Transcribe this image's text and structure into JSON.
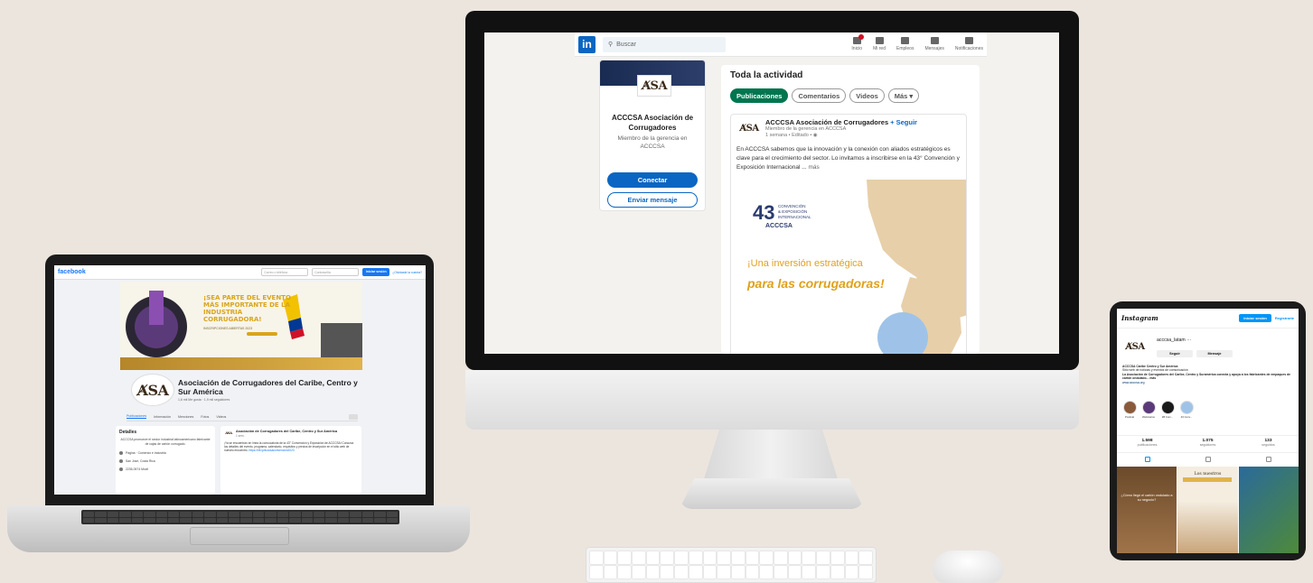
{
  "brand": {
    "logo_text": "A̸SA"
  },
  "linkedin": {
    "logo": "in",
    "search_placeholder": "Buscar",
    "nav": [
      {
        "label": "Inicio",
        "icon": "home-icon"
      },
      {
        "label": "Mi red",
        "icon": "network-icon"
      },
      {
        "label": "Empleos",
        "icon": "briefcase-icon"
      },
      {
        "label": "Mensajes",
        "icon": "message-icon"
      },
      {
        "label": "Notificaciones",
        "icon": "bell-icon"
      }
    ],
    "profile": {
      "logo": "A̸SA",
      "name": "ACCCSA Asociación de Corrugadores",
      "subtitle": "Miembro de la gerencia en ACCCSA",
      "connect_label": "Conectar",
      "message_label": "Enviar mensaje"
    },
    "feed": {
      "title": "Toda la actividad",
      "tabs": [
        "Publicaciones",
        "Comentarios",
        "Videos",
        "Más ▾"
      ],
      "post": {
        "author": "ACCCSA Asociación de Corrugadores",
        "follow_label": "+ Seguir",
        "meta_line1": "Miembro de la gerencia en ACCCSA",
        "meta_line2": "1 semana • Editado •",
        "text": "En ACCCSA sabemos que la innovación y la conexión con aliados estratégicos es clave para el crecimiento del sector. Lo invitamos a inscribirse en la 43° Convención y Exposición Internacional ...",
        "more_label": "más",
        "image": {
          "number": "43",
          "event_lines": [
            "CONVENCIÓN",
            "& EXPOSICIÓN",
            "INTERNACIONAL"
          ],
          "org": "ACCCSA",
          "headline1": "¡Una inversión estratégica",
          "headline2": "para las corrugadoras!"
        }
      }
    }
  },
  "facebook": {
    "logo": "facebook",
    "email_placeholder": "Correo o teléfono",
    "password_placeholder": "Contraseña",
    "login_label": "Iniciar sesión",
    "forgot_label": "¿Olvidaste la cuenta?",
    "cover_headline": "¡SEA PARTE DEL EVENTO MÁS IMPORTANTE DE LA INDUSTRIA CORRUGADORA!",
    "cover_sub": "INSCRIPCIONES ABIERTAS 2023",
    "page_name": "Asociación de Corrugadores del Caribe, Centro y Sur América",
    "page_meta": "1,6 mil Me gusta · 1,9 mil seguidores",
    "tabs": [
      "Publicaciones",
      "Información",
      "Menciones",
      "Fotos",
      "Videos"
    ],
    "details_title": "Detalles",
    "details_text": "ACCCSA promueve el sector industrial latinoamericano fabricante de cajas de cartón corrugado.",
    "details_rows": [
      "Página · Comercio e industria",
      "San José, Costa Rica",
      "2235-0574 Móvil"
    ],
    "post_title": "Asociación de Corrugadores del Caribe, Centro y Sur América",
    "post_date": "1 sem.",
    "post_text": "¡Ya se encuentran en línea la convocatoria de la 43° Convención y Exposición de ACCCSA! Conozca los detalles del evento, programa, calendario, requisitos y precios de inscripción en el sitio web de nuestro encuentro.",
    "post_link": "https://bit.ly/acccsaconvencion2023"
  },
  "instagram": {
    "logo": "Instagram",
    "login_label": "Iniciar sesión",
    "register_label": "Registrarte",
    "username": "acccsa_latam",
    "follow_label": "Seguir",
    "message_label": "Mensaje",
    "bio_name": "ACCCSA Caribe Centro y Sur América",
    "bio_line1": "Sitio web de noticias y eventos de comunicación",
    "bio_line2": "La Asociación de Corrugadores del Caribe, Centro y Suramérica conecta y apoya a los fabricantes de empaques de cartón ondulado... más",
    "bio_link": "www.acccsa.org",
    "highlights": [
      "Postinal",
      "Webinarios",
      "2B Cum...",
      "43 Conv..."
    ],
    "stats": [
      {
        "num": "1.598",
        "label": "publicaciones"
      },
      {
        "num": "1.075",
        "label": "seguidores"
      },
      {
        "num": "133",
        "label": "seguidos"
      }
    ],
    "posts": [
      {
        "text": "¿Cómo llegó el cartón ondulado a su negocio?"
      },
      {
        "title": "Los nuestros"
      },
      {
        "text": ""
      }
    ]
  }
}
